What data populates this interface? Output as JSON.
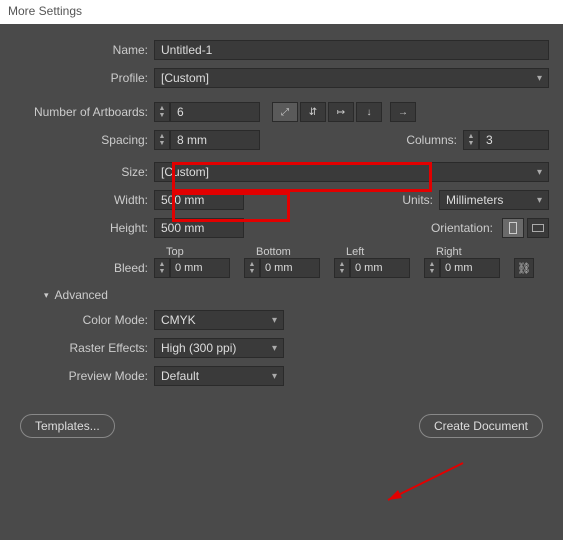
{
  "title": "More Settings",
  "labels": {
    "name": "Name:",
    "profile": "Profile:",
    "numArtboards": "Number of Artboards:",
    "spacing": "Spacing:",
    "columns": "Columns:",
    "size": "Size:",
    "width": "Width:",
    "height": "Height:",
    "units": "Units:",
    "orientation": "Orientation:",
    "bleed": "Bleed:",
    "top": "Top",
    "bottom": "Bottom",
    "left": "Left",
    "right": "Right",
    "advanced": "Advanced",
    "colorMode": "Color Mode:",
    "rasterEffects": "Raster Effects:",
    "previewMode": "Preview Mode:"
  },
  "values": {
    "name": "Untitled-1",
    "profile": "[Custom]",
    "numArtboards": "6",
    "spacing": "8 mm",
    "columns": "3",
    "size": "[Custom]",
    "width": "500 mm",
    "height": "500 mm",
    "units": "Millimeters",
    "bleedTop": "0 mm",
    "bleedBottom": "0 mm",
    "bleedLeft": "0 mm",
    "bleedRight": "0 mm",
    "colorMode": "CMYK",
    "rasterEffects": "High (300 ppi)",
    "previewMode": "Default"
  },
  "buttons": {
    "templates": "Templates...",
    "create": "Create Document"
  }
}
